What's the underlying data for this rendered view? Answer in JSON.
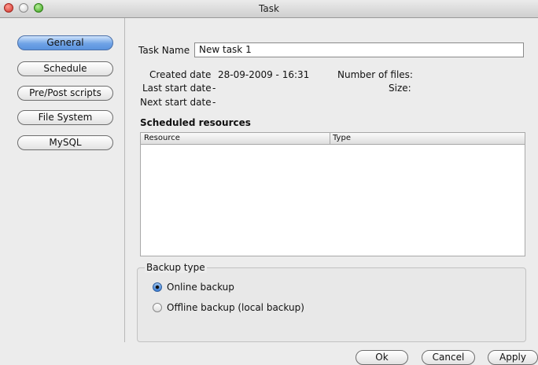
{
  "window": {
    "title": "Task"
  },
  "sidebar": {
    "items": [
      {
        "label": "General",
        "active": true
      },
      {
        "label": "Schedule",
        "active": false
      },
      {
        "label": "Pre/Post scripts",
        "active": false
      },
      {
        "label": "File System",
        "active": false
      },
      {
        "label": "MySQL",
        "active": false
      }
    ]
  },
  "general": {
    "task_name_label": "Task Name",
    "task_name_value": "New task 1",
    "created_label": "Created date",
    "created_value": "28-09-2009 - 16:31",
    "last_start_label": "Last start date",
    "last_start_value": "-",
    "next_start_label": "Next start date",
    "next_start_value": "-",
    "num_files_label": "Number of files:",
    "size_label": "Size:",
    "scheduled_resources_heading": "Scheduled resources",
    "table_columns": [
      "Resource",
      "Type"
    ],
    "backup_type_label": "Backup type",
    "backup_options": [
      {
        "label": "Online backup",
        "selected": true
      },
      {
        "label": "Offline backup (local backup)",
        "selected": false
      }
    ]
  },
  "buttons": {
    "ok": "Ok",
    "cancel": "Cancel",
    "apply": "Apply"
  }
}
